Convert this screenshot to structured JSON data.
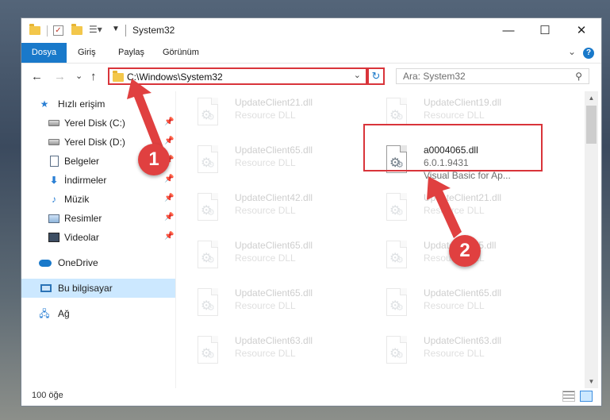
{
  "window": {
    "title": "System32",
    "minimize_icon": "—",
    "maximize_icon": "☐",
    "close_icon": "✕"
  },
  "ribbon": {
    "tabs": [
      "Dosya",
      "Giriş",
      "Paylaş",
      "Görünüm"
    ],
    "help_label": "?"
  },
  "nav": {
    "back_icon": "←",
    "forward_icon": "→",
    "recent_icon": "⌄",
    "up_icon": "↑",
    "address": "C:\\Windows\\System32",
    "search_placeholder": "Ara: System32"
  },
  "sidebar": {
    "items": [
      {
        "label": "Hızlı erişim",
        "icon": "star-icon"
      },
      {
        "label": "Yerel Disk (C:)",
        "icon": "drive-icon",
        "pinned": true
      },
      {
        "label": "Yerel Disk (D:)",
        "icon": "drive-icon",
        "pinned": true
      },
      {
        "label": "Belgeler",
        "icon": "document-icon",
        "pinned": true
      },
      {
        "label": "İndirmeler",
        "icon": "download-icon",
        "pinned": true
      },
      {
        "label": "Müzik",
        "icon": "music-icon",
        "pinned": true
      },
      {
        "label": "Resimler",
        "icon": "picture-icon",
        "pinned": true
      },
      {
        "label": "Videolar",
        "icon": "video-icon",
        "pinned": true
      },
      {
        "label": "OneDrive",
        "icon": "cloud-icon"
      },
      {
        "label": "Bu bilgisayar",
        "icon": "computer-icon",
        "selected": true
      },
      {
        "label": "Ağ",
        "icon": "network-icon"
      }
    ]
  },
  "files": {
    "left": [
      {
        "name": "UpdateClient21.dll",
        "desc": "Resource DLL"
      },
      {
        "name": "UpdateClient65.dll",
        "desc": "Resource DLL"
      },
      {
        "name": "UpdateClient42.dll",
        "desc": "Resource DLL"
      },
      {
        "name": "UpdateClient65.dll",
        "desc": "Resource DLL"
      },
      {
        "name": "UpdateClient65.dll",
        "desc": "Resource DLL"
      },
      {
        "name": "UpdateClient63.dll",
        "desc": "Resource DLL"
      }
    ],
    "right": [
      {
        "name": "UpdateClient19.dll",
        "desc": "Resource DLL"
      },
      {
        "name": "UpdateClient21.dll",
        "desc": "Resource DLL"
      },
      {
        "name": "UpdateClient5.dll",
        "desc": "Resource DLL"
      },
      {
        "name": "UpdateClient65.dll",
        "desc": "Resource DLL"
      },
      {
        "name": "UpdateClient63.dll",
        "desc": "Resource DLL"
      }
    ],
    "highlighted": {
      "name": "a0004065.dll",
      "version": "6.0.1.9431",
      "desc": "Visual Basic for Ap..."
    }
  },
  "status": {
    "item_count": "100 öğe"
  },
  "annotations": {
    "marker1": "1",
    "marker2": "2",
    "color": "#e04040"
  },
  "colors": {
    "accent": "#1979ca",
    "highlight_border": "#d9343a",
    "selection": "#cce8ff"
  }
}
